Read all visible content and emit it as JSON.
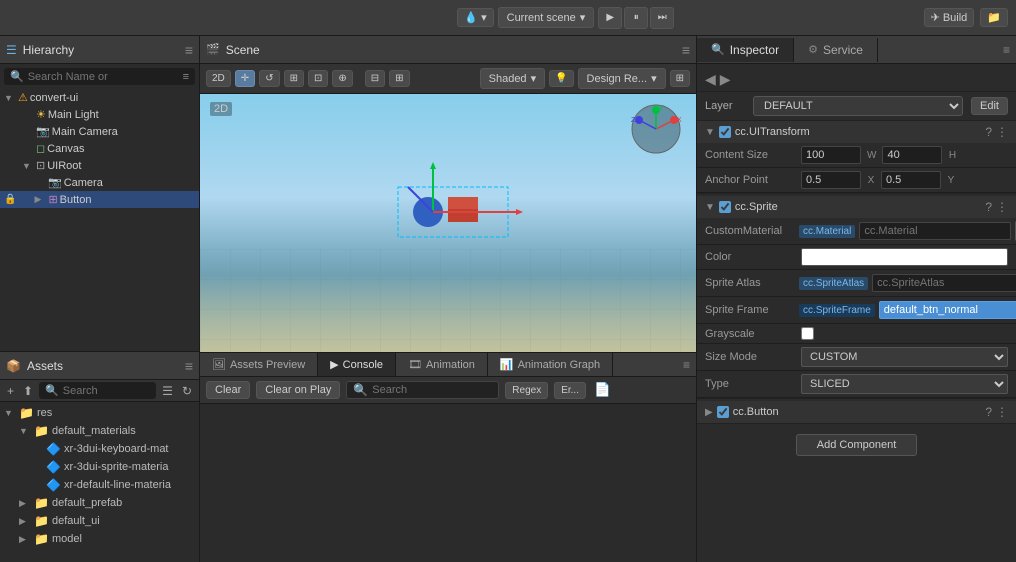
{
  "topbar": {
    "dropdown1_label": "Current scene",
    "build_label": "Build",
    "play_icon": "▶",
    "pause_icon": "⏸",
    "step_icon": "⏭"
  },
  "hierarchy": {
    "title": "Hierarchy",
    "search_placeholder": "Search Name or",
    "items": [
      {
        "label": "convert-ui",
        "indent": 0,
        "type": "scene",
        "expanded": true
      },
      {
        "label": "Main Light",
        "indent": 1,
        "type": "light"
      },
      {
        "label": "Main Camera",
        "indent": 1,
        "type": "camera"
      },
      {
        "label": "Canvas",
        "indent": 1,
        "type": "canvas"
      },
      {
        "label": "UIRoot",
        "indent": 1,
        "type": "ui",
        "expanded": true
      },
      {
        "label": "Camera",
        "indent": 2,
        "type": "camera"
      },
      {
        "label": "Button",
        "indent": 2,
        "type": "button",
        "collapsed": true,
        "selected": true
      }
    ]
  },
  "assets": {
    "title": "Assets",
    "search_placeholder": "Search",
    "items": [
      {
        "label": "res",
        "indent": 0,
        "type": "folder",
        "expanded": true
      },
      {
        "label": "default_materials",
        "indent": 1,
        "type": "folder",
        "expanded": true
      },
      {
        "label": "xr-3dui-keyboard-mat",
        "indent": 2,
        "type": "file"
      },
      {
        "label": "xr-3dui-sprite-materia",
        "indent": 2,
        "type": "file"
      },
      {
        "label": "xr-default-line-materia",
        "indent": 2,
        "type": "file"
      },
      {
        "label": "default_prefab",
        "indent": 1,
        "type": "folder"
      },
      {
        "label": "default_ui",
        "indent": 1,
        "type": "folder"
      },
      {
        "label": "model",
        "indent": 1,
        "type": "folder"
      }
    ]
  },
  "scene": {
    "title": "Scene",
    "mode_label": "Shaded",
    "design_label": "Design Re..."
  },
  "console_tabs": [
    {
      "label": "Assets Preview",
      "active": false
    },
    {
      "label": "Console",
      "active": true
    },
    {
      "label": "Animation",
      "active": false
    },
    {
      "label": "Animation Graph",
      "active": false
    }
  ],
  "console": {
    "clear_label": "Clear",
    "clear_on_play_label": "Clear on Play",
    "search_placeholder": "Search",
    "regex_label": "Regex",
    "er_label": "Er..."
  },
  "inspector": {
    "title": "Inspector",
    "service_title": "Service",
    "layer_label": "Layer",
    "layer_value": "DEFAULT",
    "edit_label": "Edit",
    "components": [
      {
        "name": "cc.UITransform",
        "props": [
          {
            "label": "Content Size",
            "value1": "100",
            "axis1": "W",
            "value2": "40",
            "axis2": "H"
          },
          {
            "label": "Anchor Point",
            "value1": "0.5",
            "axis1": "X",
            "value2": "0.5",
            "axis2": "Y"
          }
        ]
      },
      {
        "name": "cc.Sprite",
        "props_special": true,
        "custom_material_label": "CustomMaterial",
        "material_tag": "cc.Material",
        "material_value": "cc.Material",
        "color_label": "Color",
        "sprite_atlas_label": "Sprite Atlas",
        "atlas_tag": "cc.SpriteAtlas",
        "atlas_value": "cc.SpriteAtlas",
        "sprite_frame_label": "Sprite Frame",
        "frame_tag": "cc.SpriteFrame",
        "frame_value": "default_btn_normal",
        "grayscale_label": "Grayscale",
        "size_mode_label": "Size Mode",
        "size_mode_value": "CUSTOM",
        "type_label": "Type",
        "type_value": "SLICED"
      },
      {
        "name": "cc.Button"
      }
    ],
    "add_component_label": "Add Component"
  }
}
